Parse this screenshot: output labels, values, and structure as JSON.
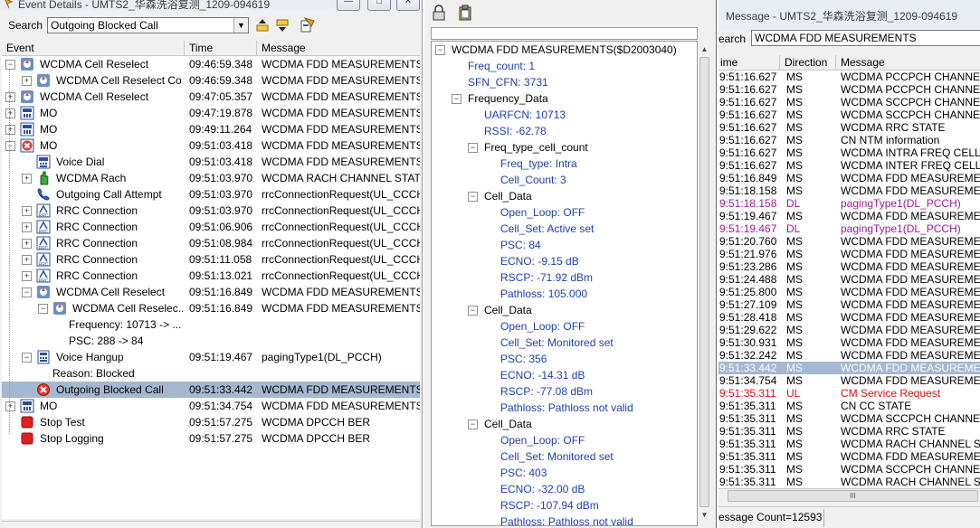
{
  "event_window": {
    "title": "Event Details - UMTS2_华森洗浴复测_1209-094619",
    "search_label": "Search",
    "search_value": "Outgoing Blocked Call",
    "columns": [
      "Event",
      "Time",
      "Message"
    ],
    "rows": [
      {
        "expander": "−",
        "icon": "reselect-icon",
        "event": "WCDMA Cell Reselect",
        "time": "09:46:59.348",
        "message": "WCDMA FDD MEASUREMENTS"
      },
      {
        "expander": "+",
        "icon": "reselect-icon",
        "event": "WCDMA Cell Reselect Co...",
        "time": "09:46:59.348",
        "message": "WCDMA FDD MEASUREMENTS"
      },
      {
        "expander": "+",
        "icon": "reselect-icon",
        "event": "WCDMA Cell Reselect",
        "time": "09:47:05.357",
        "message": "WCDMA FDD MEASUREMENTS"
      },
      {
        "expander": "+",
        "icon": "mo-icon",
        "event": "MO",
        "time": "09:47:19.878",
        "message": "WCDMA FDD MEASUREMENTS"
      },
      {
        "expander": "+",
        "icon": "mo-icon",
        "event": "MO",
        "time": "09:49:11.264",
        "message": "WCDMA FDD MEASUREMENTS"
      },
      {
        "expander": "−",
        "icon": "mo-blocked-icon",
        "event": "MO",
        "time": "09:51:03.418",
        "message": "WCDMA FDD MEASUREMENTS"
      },
      {
        "expander": "",
        "icon": "voice-dial-icon",
        "event": "Voice Dial",
        "time": "09:51:03.418",
        "message": "WCDMA FDD MEASUREMENTS"
      },
      {
        "expander": "+",
        "icon": "rach-icon",
        "event": "WCDMA Rach",
        "time": "09:51:03.970",
        "message": "WCDMA RACH CHANNEL STATUS"
      },
      {
        "expander": "",
        "icon": "call-attempt-icon",
        "event": "Outgoing Call Attempt",
        "time": "09:51:03.970",
        "message": "rrcConnectionRequest(UL_CCCH)"
      },
      {
        "expander": "+",
        "icon": "rrc-icon",
        "event": "RRC Connection",
        "time": "09:51:03.970",
        "message": "rrcConnectionRequest(UL_CCCH)"
      },
      {
        "expander": "+",
        "icon": "rrc-icon",
        "event": "RRC Connection",
        "time": "09:51:06.906",
        "message": "rrcConnectionRequest(UL_CCCH)"
      },
      {
        "expander": "+",
        "icon": "rrc-icon",
        "event": "RRC Connection",
        "time": "09:51:08.984",
        "message": "rrcConnectionRequest(UL_CCCH)"
      },
      {
        "expander": "+",
        "icon": "rrc-icon",
        "event": "RRC Connection",
        "time": "09:51:11.058",
        "message": "rrcConnectionRequest(UL_CCCH)"
      },
      {
        "expander": "+",
        "icon": "rrc-icon",
        "event": "RRC Connection",
        "time": "09:51:13.021",
        "message": "rrcConnectionRequest(UL_CCCH)"
      },
      {
        "expander": "−",
        "icon": "reselect-icon",
        "event": "WCDMA Cell Reselect",
        "time": "09:51:16.849",
        "message": "WCDMA FDD MEASUREMENTS"
      },
      {
        "expander": "−",
        "icon": "reselect-icon",
        "event": "WCDMA Cell Reselec...",
        "time": "09:51:16.849",
        "message": "WCDMA FDD MEASUREMENTS"
      },
      {
        "expander": "",
        "icon": "",
        "event": "Frequency: 10713 -> ...",
        "time": "",
        "message": ""
      },
      {
        "expander": "",
        "icon": "",
        "event": "PSC: 288 -> 84",
        "time": "",
        "message": ""
      },
      {
        "expander": "−",
        "icon": "voice-hangup-icon",
        "event": "Voice Hangup",
        "time": "09:51:19.467",
        "message": "pagingType1(DL_PCCH)"
      },
      {
        "expander": "",
        "icon": "",
        "event": "Reason: Blocked",
        "time": "",
        "message": ""
      },
      {
        "expander": "",
        "icon": "blocked-call-icon",
        "event": "Outgoing Blocked Call",
        "time": "09:51:33.442",
        "message": "WCDMA FDD MEASUREMENTS"
      },
      {
        "expander": "+",
        "icon": "mo-icon",
        "event": "MO",
        "time": "09:51:34.754",
        "message": "WCDMA FDD MEASUREMENTS"
      },
      {
        "expander": "",
        "icon": "stop-icon",
        "event": "Stop Test",
        "time": "09:51:57.275",
        "message": "WCDMA DPCCH BER"
      },
      {
        "expander": "",
        "icon": "stop-icon",
        "event": "Stop Logging",
        "time": "09:51:57.275",
        "message": "WCDMA DPCCH BER"
      }
    ],
    "selected_row": 20
  },
  "detail_window": {
    "rows": [
      {
        "depth": 0,
        "expander": "−",
        "text": "WCDMA FDD MEASUREMENTS($D2003040)",
        "blue": false
      },
      {
        "depth": 1,
        "expander": "",
        "text": "Freq_count: 1",
        "blue": true
      },
      {
        "depth": 1,
        "expander": "",
        "text": "SFN_CFN: 3731",
        "blue": true
      },
      {
        "depth": 1,
        "expander": "−",
        "text": "Frequency_Data",
        "blue": false
      },
      {
        "depth": 2,
        "expander": "",
        "text": "UARFCN: 10713",
        "blue": true
      },
      {
        "depth": 2,
        "expander": "",
        "text": "RSSI: -62.78",
        "blue": true
      },
      {
        "depth": 2,
        "expander": "−",
        "text": "Freq_type_cell_count",
        "blue": false
      },
      {
        "depth": 3,
        "expander": "",
        "text": "Freq_type: Intra",
        "blue": true
      },
      {
        "depth": 3,
        "expander": "",
        "text": "Cell_Count: 3",
        "blue": true
      },
      {
        "depth": 2,
        "expander": "−",
        "text": "Cell_Data",
        "blue": false
      },
      {
        "depth": 3,
        "expander": "",
        "text": "Open_Loop: OFF",
        "blue": true
      },
      {
        "depth": 3,
        "expander": "",
        "text": "Cell_Set: Active set",
        "blue": true
      },
      {
        "depth": 3,
        "expander": "",
        "text": "PSC: 84",
        "blue": true
      },
      {
        "depth": 3,
        "expander": "",
        "text": "ECNO: -9.15 dB",
        "blue": true
      },
      {
        "depth": 3,
        "expander": "",
        "text": "RSCP: -71.92 dBm",
        "blue": true
      },
      {
        "depth": 3,
        "expander": "",
        "text": "Pathloss: 105.000",
        "blue": true
      },
      {
        "depth": 2,
        "expander": "−",
        "text": "Cell_Data",
        "blue": false
      },
      {
        "depth": 3,
        "expander": "",
        "text": "Open_Loop: OFF",
        "blue": true
      },
      {
        "depth": 3,
        "expander": "",
        "text": "Cell_Set: Monitored set",
        "blue": true
      },
      {
        "depth": 3,
        "expander": "",
        "text": "PSC: 356",
        "blue": true
      },
      {
        "depth": 3,
        "expander": "",
        "text": "ECNO: -14.31 dB",
        "blue": true
      },
      {
        "depth": 3,
        "expander": "",
        "text": "RSCP: -77.08 dBm",
        "blue": true
      },
      {
        "depth": 3,
        "expander": "",
        "text": "Pathloss: Pathloss not valid",
        "blue": true
      },
      {
        "depth": 2,
        "expander": "−",
        "text": "Cell_Data",
        "blue": false
      },
      {
        "depth": 3,
        "expander": "",
        "text": "Open_Loop: OFF",
        "blue": true
      },
      {
        "depth": 3,
        "expander": "",
        "text": "Cell_Set: Monitored set",
        "blue": true
      },
      {
        "depth": 3,
        "expander": "",
        "text": "PSC: 403",
        "blue": true
      },
      {
        "depth": 3,
        "expander": "",
        "text": "ECNO: -32.00 dB",
        "blue": true
      },
      {
        "depth": 3,
        "expander": "",
        "text": "RSCP: -107.94 dBm",
        "blue": true
      },
      {
        "depth": 3,
        "expander": "",
        "text": "Pathloss: Pathloss not valid",
        "blue": true
      }
    ]
  },
  "message_window": {
    "title": "Message - UMTS2_华森洗浴复测_1209-094619",
    "search_label": "earch",
    "search_value": "WCDMA FDD MEASUREMENTS",
    "columns": [
      "ime",
      "Direction",
      "Message"
    ],
    "rows": [
      {
        "time": "9:51:16.627",
        "dir": "MS",
        "msg": "WCDMA PCCPCH CHANNEL ST",
        "kind": ""
      },
      {
        "time": "9:51:16.627",
        "dir": "MS",
        "msg": "WCDMA PCCPCH CHANNEL ST",
        "kind": ""
      },
      {
        "time": "9:51:16.627",
        "dir": "MS",
        "msg": "WCDMA SCCPCH CHANNEL ST",
        "kind": ""
      },
      {
        "time": "9:51:16.627",
        "dir": "MS",
        "msg": "WCDMA SCCPCH CHANNEL ST",
        "kind": ""
      },
      {
        "time": "9:51:16.627",
        "dir": "MS",
        "msg": "WCDMA RRC STATE",
        "kind": ""
      },
      {
        "time": "9:51:16.627",
        "dir": "MS",
        "msg": "CN NTM information",
        "kind": ""
      },
      {
        "time": "9:51:16.627",
        "dir": "MS",
        "msg": "WCDMA INTRA FREQ CELL LIS",
        "kind": ""
      },
      {
        "time": "9:51:16.627",
        "dir": "MS",
        "msg": "WCDMA INTER FREQ CELL LIS",
        "kind": ""
      },
      {
        "time": "9:51:16.849",
        "dir": "MS",
        "msg": "WCDMA FDD MEASUREMENT",
        "kind": ""
      },
      {
        "time": "9:51:18.158",
        "dir": "MS",
        "msg": "WCDMA FDD MEASUREMENT",
        "kind": ""
      },
      {
        "time": "9:51:18.158",
        "dir": "DL",
        "msg": "pagingType1(DL_PCCH)",
        "kind": "dl"
      },
      {
        "time": "9:51:19.467",
        "dir": "MS",
        "msg": "WCDMA FDD MEASUREMENT",
        "kind": ""
      },
      {
        "time": "9:51:19.467",
        "dir": "DL",
        "msg": "pagingType1(DL_PCCH)",
        "kind": "dl"
      },
      {
        "time": "9:51:20.760",
        "dir": "MS",
        "msg": "WCDMA FDD MEASUREMENT",
        "kind": ""
      },
      {
        "time": "9:51:21.976",
        "dir": "MS",
        "msg": "WCDMA FDD MEASUREMENT",
        "kind": ""
      },
      {
        "time": "9:51:23.286",
        "dir": "MS",
        "msg": "WCDMA FDD MEASUREMENT",
        "kind": ""
      },
      {
        "time": "9:51:24.488",
        "dir": "MS",
        "msg": "WCDMA FDD MEASUREMENT",
        "kind": ""
      },
      {
        "time": "9:51:25.800",
        "dir": "MS",
        "msg": "WCDMA FDD MEASUREMENT",
        "kind": ""
      },
      {
        "time": "9:51:27.109",
        "dir": "MS",
        "msg": "WCDMA FDD MEASUREMENT",
        "kind": ""
      },
      {
        "time": "9:51:28.418",
        "dir": "MS",
        "msg": "WCDMA FDD MEASUREMENT",
        "kind": ""
      },
      {
        "time": "9:51:29.622",
        "dir": "MS",
        "msg": "WCDMA FDD MEASUREMENT",
        "kind": ""
      },
      {
        "time": "9:51:30.931",
        "dir": "MS",
        "msg": "WCDMA FDD MEASUREMENT",
        "kind": ""
      },
      {
        "time": "9:51:32.242",
        "dir": "MS",
        "msg": "WCDMA FDD MEASUREMENT",
        "kind": ""
      },
      {
        "time": "9:51:33.442",
        "dir": "MS",
        "msg": "WCDMA FDD MEASUREMENT",
        "kind": "sel"
      },
      {
        "time": "9:51:34.754",
        "dir": "MS",
        "msg": "WCDMA FDD MEASUREMENT",
        "kind": ""
      },
      {
        "time": "9:51:35.311",
        "dir": "UL",
        "msg": "CM Service Request",
        "kind": "ul"
      },
      {
        "time": "9:51:35.311",
        "dir": "MS",
        "msg": "CN CC STATE",
        "kind": ""
      },
      {
        "time": "9:51:35.311",
        "dir": "MS",
        "msg": "WCDMA SCCPCH CHANNEL ST",
        "kind": ""
      },
      {
        "time": "9:51:35.311",
        "dir": "MS",
        "msg": "WCDMA RRC STATE",
        "kind": ""
      },
      {
        "time": "9:51:35.311",
        "dir": "MS",
        "msg": "WCDMA RACH CHANNEL STA",
        "kind": ""
      },
      {
        "time": "9:51:35.311",
        "dir": "MS",
        "msg": "WCDMA FDD MEASUREMENT",
        "kind": ""
      },
      {
        "time": "9:51:35.311",
        "dir": "MS",
        "msg": "WCDMA SCCPCH CHANNEL ST",
        "kind": ""
      },
      {
        "time": "9:51:35.311",
        "dir": "MS",
        "msg": "WCDMA RACH CHANNEL STA",
        "kind": ""
      }
    ],
    "status": "essage Count=12593",
    "hscroll_grip": "III"
  }
}
